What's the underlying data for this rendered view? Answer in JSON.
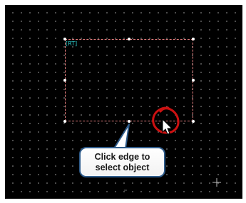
{
  "canvas": {
    "object_label": "[RT]"
  },
  "callout": {
    "line1": "Click edge to",
    "line2": "select object"
  },
  "colors": {
    "canvas_bg": "#000000",
    "grid_dot": "#5a5a5a",
    "selection_outline": "#e88080",
    "label_color": "#2fd0d0",
    "highlight_circle": "#cc1111",
    "callout_border": "#2e5b8a"
  },
  "icons": {
    "cursor": "mouse-pointer-icon",
    "crosshair": "crosshair-icon"
  }
}
